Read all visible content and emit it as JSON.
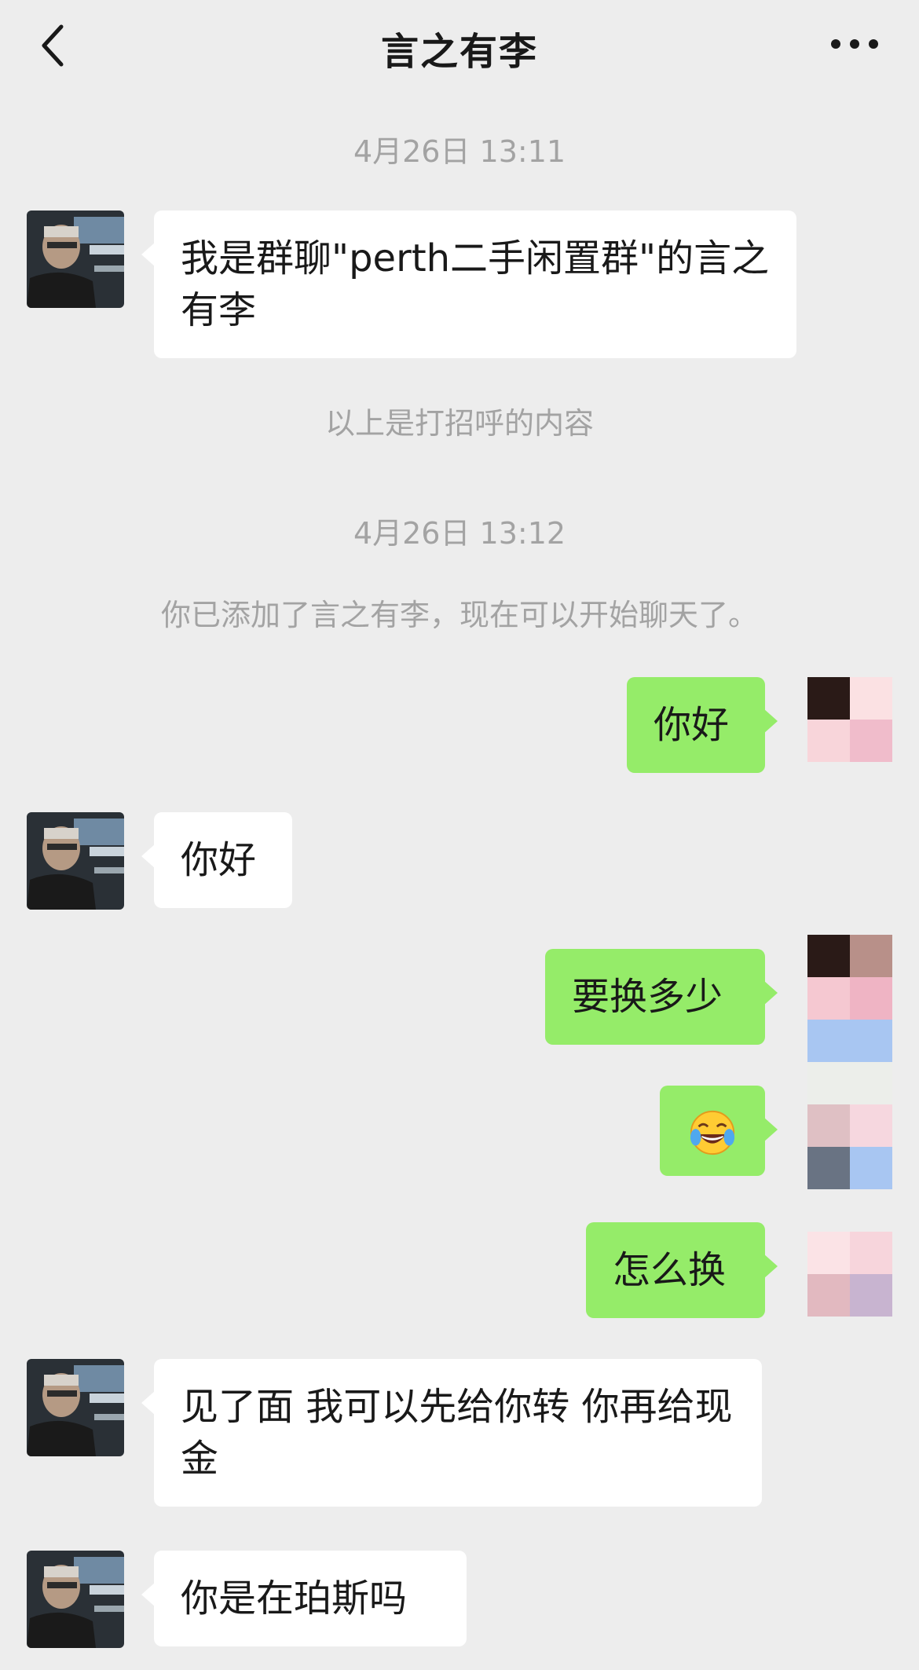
{
  "header": {
    "title": "言之有李"
  },
  "timestamps": [
    "4月26日 13:11",
    "4月26日 13:12"
  ],
  "system": {
    "greeting_note": "以上是打招呼的内容",
    "added_note": "你已添加了言之有李，现在可以开始聊天了。"
  },
  "messages": [
    {
      "from": "them",
      "text": "我是群聊\"perth二手闲置群\"的言之有李"
    },
    {
      "from": "me",
      "text": "你好"
    },
    {
      "from": "them",
      "text": "你好"
    },
    {
      "from": "me",
      "text": "要换多少"
    },
    {
      "from": "me",
      "text": "",
      "emoji": "tears-of-joy-emoji"
    },
    {
      "from": "me",
      "text": "怎么换"
    },
    {
      "from": "them",
      "text": "见了面 我可以先给你转 你再给现金"
    },
    {
      "from": "them",
      "text": "你是在珀斯吗"
    }
  ],
  "colors": {
    "background": "#ededed",
    "bubble_in": "#ffffff",
    "bubble_out": "#95ec69",
    "system_text": "#a3a3a3"
  },
  "icons": [
    "back-arrow-icon",
    "more-dots-icon",
    "tears-of-joy-emoji"
  ]
}
